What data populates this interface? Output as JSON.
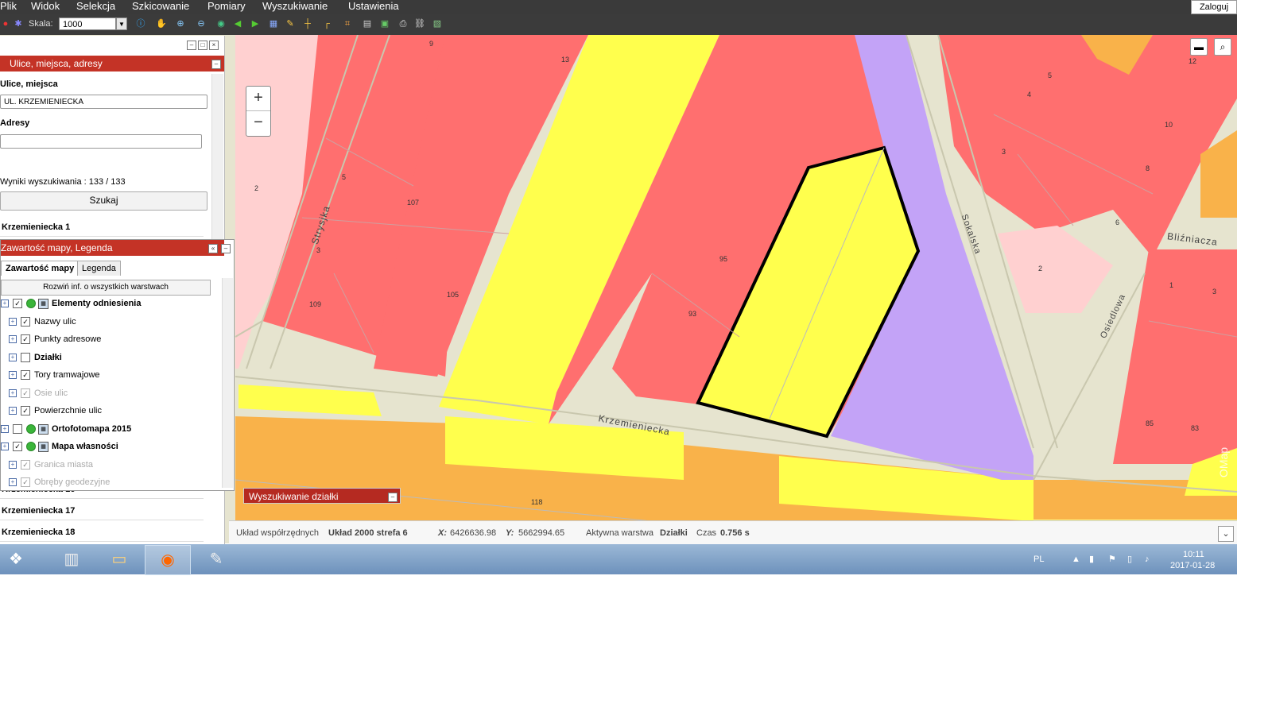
{
  "menu": [
    "Plik",
    "Widok",
    "Selekcja",
    "Szkicowanie",
    "Pomiary",
    "Wyszukiwanie",
    "Ustawienia"
  ],
  "login_label": "Zaloguj",
  "toolbar": {
    "scale_label": "Skala:",
    "scale_value": "1000"
  },
  "search_panel": {
    "title": "Ulice, miejsca, adresy",
    "streets_label": "Ulice, miejsca",
    "streets_value": "UL. KRZEMIENIECKA",
    "address_label": "Adresy",
    "address_value": "",
    "search_button": "Szukaj",
    "results_info": "Wyniki wyszukiwania : 133 / 133",
    "results": [
      "Krzemieniecka 1",
      "Krzemieniecka 16",
      "Krzemieniecka 17",
      "Krzemieniecka 18"
    ]
  },
  "legend_panel": {
    "title": "Zawartość mapy, Legenda",
    "tabs": [
      "Zawartość mapy",
      "Legenda"
    ],
    "expand_all": "Rozwiń inf. o wszystkich warstwach",
    "layers": [
      {
        "label": "Elementy odniesienia",
        "bold": true,
        "checked": true,
        "group": true
      },
      {
        "label": "Nazwy ulic",
        "bold": false,
        "checked": true,
        "group": false
      },
      {
        "label": "Punkty adresowe",
        "bold": false,
        "checked": true,
        "group": false
      },
      {
        "label": "Działki",
        "bold": true,
        "checked": false,
        "group": false
      },
      {
        "label": "Tory tramwajowe",
        "bold": false,
        "checked": true,
        "group": false
      },
      {
        "label": "Osie ulic",
        "bold": false,
        "checked": true,
        "group": false,
        "disabled": true
      },
      {
        "label": "Powierzchnie ulic",
        "bold": false,
        "checked": true,
        "group": false
      },
      {
        "label": "Ortofotomapa 2015",
        "bold": true,
        "checked": false,
        "group": true
      },
      {
        "label": "Mapa własności",
        "bold": true,
        "checked": true,
        "group": true
      },
      {
        "label": "Granica miasta",
        "bold": false,
        "checked": true,
        "group": false,
        "disabled": true
      },
      {
        "label": "Obręby geodezyjne",
        "bold": false,
        "checked": true,
        "group": false,
        "disabled": true
      }
    ]
  },
  "parcel_search": {
    "title": "Wyszukiwanie działki"
  },
  "map": {
    "streets": [
      "Strysjka",
      "Krzemieniecka",
      "Sokalska",
      "Osiedlowa",
      "Bliźniacza"
    ],
    "plot_numbers": [
      "9",
      "13",
      "2",
      "5",
      "107",
      "3",
      "109",
      "105",
      "95",
      "93",
      "118",
      "5",
      "4",
      "3",
      "12",
      "10",
      "8",
      "6",
      "2",
      "1",
      "3",
      "85",
      "83"
    ],
    "watermark": "OMap"
  },
  "status": {
    "crs_label": "Układ współrzędnych",
    "crs_value": "Układ 2000 strefa 6",
    "x_label": "X:",
    "x_value": "6426636.98",
    "y_label": "Y:",
    "y_value": "5662994.65",
    "layer_label": "Aktywna warstwa",
    "layer_value": "Działki",
    "time_label": "Czas",
    "time_value": "0.756 s"
  },
  "taskbar": {
    "lang": "PL",
    "time": "10:11",
    "date": "2017-01-28"
  },
  "colors": {
    "red_parcel": "#ff6f6f",
    "yellow_parcel": "#ffff4d",
    "purple_parcel": "#c3a3f7",
    "orange_parcel": "#f9b24a",
    "road": "#e6e4cf",
    "panel_title": "#c43326"
  }
}
